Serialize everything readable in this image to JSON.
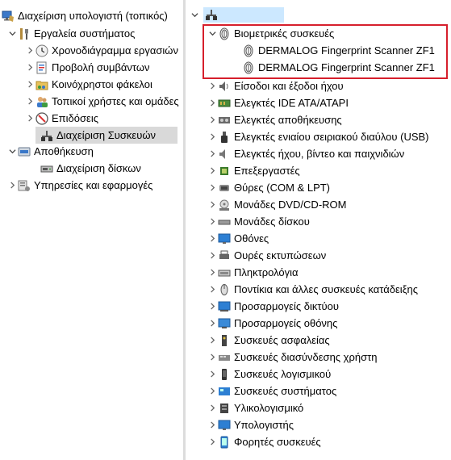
{
  "left_tree": {
    "root": "Διαχείριση υπολογιστή (τοπικός)",
    "system_tools": "Εργαλεία συστήματος",
    "task_scheduler": "Χρονοδιάγραμμα εργασιών",
    "event_viewer": "Προβολή συμβάντων",
    "shared_folders": "Κοινόχρηστοι φάκελοι",
    "local_users": "Τοπικοί χρήστες και ομάδες",
    "performance": "Επιδόσεις",
    "device_manager": "Διαχείριση Συσκευών",
    "storage": "Αποθήκευση",
    "disk_management": "Διαχείριση δίσκων",
    "services": "Υπηρεσίες και εφαρμογές"
  },
  "right_tree": {
    "biometric": "Βιομετρικές συσκευές",
    "biometric_children": [
      "DERMALOG Fingerprint Scanner ZF1",
      "DERMALOG Fingerprint Scanner ZF1"
    ],
    "categories": [
      "Είσοδοι και έξοδοι ήχου",
      "Ελεγκτές IDE ATA/ATAPI",
      "Ελεγκτές αποθήκευσης",
      "Ελεγκτές ενιαίου σειριακού διαύλου (USB)",
      "Ελεγκτές ήχου, βίντεο και παιχνιδιών",
      "Επεξεργαστές",
      "Θύρες (COM & LPT)",
      "Μονάδες DVD/CD-ROM",
      "Μονάδες δίσκου",
      "Οθόνες",
      "Ουρές εκτυπώσεων",
      "Πληκτρολόγια",
      "Ποντίκια και άλλες συσκευές κατάδειξης",
      "Προσαρμογείς δικτύου",
      "Προσαρμογείς οθόνης",
      "Συσκευές ασφαλείας",
      "Συσκευές διασύνδεσης χρήστη",
      "Συσκευές λογισμικού",
      "Συσκευές συστήματος",
      "Υλικολογισμικό",
      "Υπολογιστής",
      "Φορητές συσκευές"
    ]
  },
  "colors": {
    "highlight_border": "#d61f2c",
    "selection": "#d9d9d9",
    "root_selection": "#cce8ff"
  }
}
